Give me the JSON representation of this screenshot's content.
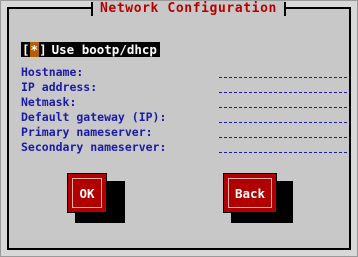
{
  "dialog": {
    "title": "Network Configuration",
    "bootp": {
      "checked": true,
      "mark": "*",
      "label": "Use bootp/dhcp"
    },
    "fields": [
      {
        "label": "Hostname:",
        "value": ""
      },
      {
        "label": "IP address:",
        "value": ""
      },
      {
        "label": "Netmask:",
        "value": ""
      },
      {
        "label": "Default gateway (IP):",
        "value": ""
      },
      {
        "label": "Primary nameserver:",
        "value": ""
      },
      {
        "label": "Secondary nameserver:",
        "value": ""
      }
    ],
    "buttons": {
      "ok": "OK",
      "back": "Back"
    }
  },
  "colors": {
    "title": "#b80000",
    "label": "#1a1aa8",
    "button": "#b00000",
    "background": "#c8c8c8"
  }
}
